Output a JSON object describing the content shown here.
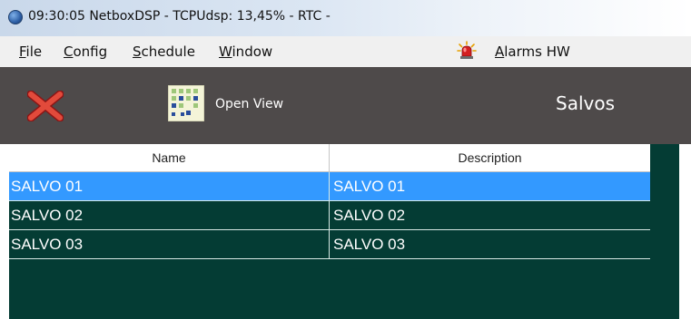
{
  "window": {
    "title": "09:30:05   NetboxDSP - TCPUdsp: 13,45% -  RTC  -"
  },
  "menu": {
    "file": {
      "accel": "F",
      "rest": "ile"
    },
    "config": {
      "accel": "C",
      "rest": "onfig"
    },
    "schedule": {
      "accel": "S",
      "rest": "chedule"
    },
    "window": {
      "accel": "W",
      "rest": "indow"
    },
    "alarms": {
      "accel": "A",
      "rest": "larms HW"
    }
  },
  "toolbar": {
    "open_view_label": "Open View",
    "page_title": "Salvos"
  },
  "table": {
    "columns": [
      "Name",
      "Description"
    ],
    "rows": [
      {
        "name": "SALVO 01",
        "description": "SALVO 01",
        "selected": true
      },
      {
        "name": "SALVO 02",
        "description": "SALVO 02",
        "selected": false
      },
      {
        "name": "SALVO 03",
        "description": "SALVO 03",
        "selected": false
      }
    ]
  },
  "colors": {
    "toolbar_bg": "#4e4a4a",
    "content_bg": "#043c34",
    "selection": "#3399ff"
  },
  "icons": {
    "app": "globe-icon",
    "alarm": "alarm-bell-icon",
    "close": "close-x-icon",
    "open_view": "grid-view-icon"
  }
}
